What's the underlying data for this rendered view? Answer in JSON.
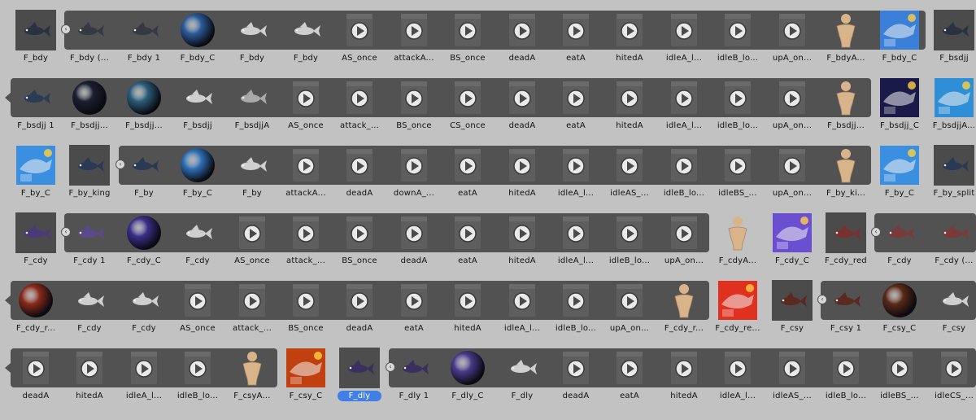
{
  "rows": [
    {
      "items": [
        {
          "label": "F_bdy",
          "icon": "mesh-icon",
          "tint": "#2a3140",
          "boxed": true
        },
        {
          "label": "F_bdy (...",
          "icon": "fish-icon",
          "tint": "#353a42"
        },
        {
          "label": "F_bdy 1",
          "icon": "fish-icon",
          "tint": "#353a42"
        },
        {
          "label": "F_bdy_C",
          "icon": "sphere-icon",
          "tint": "#2b5b9a"
        },
        {
          "label": "F_bdy",
          "icon": "fish-icon",
          "tint": "#cfcfcf"
        },
        {
          "label": "F_bdy",
          "icon": "fish-icon",
          "tint": "#cfcfcf"
        },
        {
          "label": "AS_once",
          "icon": "animation-clip-icon"
        },
        {
          "label": "attackA...",
          "icon": "animation-clip-icon"
        },
        {
          "label": "BS_once",
          "icon": "animation-clip-icon"
        },
        {
          "label": "deadA",
          "icon": "animation-clip-icon"
        },
        {
          "label": "eatA",
          "icon": "animation-clip-icon"
        },
        {
          "label": "hitedA",
          "icon": "animation-clip-icon"
        },
        {
          "label": "idleA_l...",
          "icon": "animation-clip-icon"
        },
        {
          "label": "idleB_lo...",
          "icon": "animation-clip-icon"
        },
        {
          "label": "upA_on...",
          "icon": "animation-clip-icon"
        },
        {
          "label": "F_bdyA...",
          "icon": "avatar-icon"
        },
        {
          "label": "F_bdy_C",
          "icon": "texture-icon",
          "tint": "#3a7fd8"
        },
        {
          "label": "F_bsdjj",
          "icon": "mesh-icon",
          "tint": "#2a3140",
          "boxed": true
        }
      ]
    },
    {
      "items": [
        {
          "label": "F_bsdjj 1",
          "icon": "fish-icon",
          "tint": "#2a3b55"
        },
        {
          "label": "F_bsdjj...",
          "icon": "sphere-icon",
          "tint": "#1b2030"
        },
        {
          "label": "F_bsdjj...",
          "icon": "sphere-icon",
          "tint": "#2b5e7a"
        },
        {
          "label": "F_bsdjj",
          "icon": "fish-icon",
          "tint": "#cfcfcf"
        },
        {
          "label": "F_bsdjjA",
          "icon": "fish-icon",
          "tint": "#a9a9a9"
        },
        {
          "label": "AS_once",
          "icon": "animation-clip-icon"
        },
        {
          "label": "attack_...",
          "icon": "animation-clip-icon"
        },
        {
          "label": "BS_once",
          "icon": "animation-clip-icon"
        },
        {
          "label": "CS_once",
          "icon": "animation-clip-icon"
        },
        {
          "label": "deadA",
          "icon": "animation-clip-icon"
        },
        {
          "label": "eatA",
          "icon": "animation-clip-icon"
        },
        {
          "label": "hitedA",
          "icon": "animation-clip-icon"
        },
        {
          "label": "idleA_l...",
          "icon": "animation-clip-icon"
        },
        {
          "label": "idleB_lo...",
          "icon": "animation-clip-icon"
        },
        {
          "label": "upA_on...",
          "icon": "animation-clip-icon"
        },
        {
          "label": "F_bsdjj...",
          "icon": "avatar-icon"
        },
        {
          "label": "F_bsdjj_C",
          "icon": "texture-icon",
          "tint": "#1a1a4a"
        },
        {
          "label": "F_bsdjjA...",
          "icon": "texture-icon",
          "tint": "#2f8fd6"
        }
      ]
    },
    {
      "items": [
        {
          "label": "F_by_C",
          "icon": "texture-icon",
          "tint": "#3a8fe0"
        },
        {
          "label": "F_by_king",
          "icon": "mesh-icon",
          "tint": "#2a3a55",
          "boxed": true
        },
        {
          "label": "F_by",
          "icon": "fish-icon",
          "tint": "#2a3a55"
        },
        {
          "label": "F_by_C",
          "icon": "sphere-icon",
          "tint": "#2e6fb5"
        },
        {
          "label": "F_by",
          "icon": "fish-icon",
          "tint": "#cfcfcf"
        },
        {
          "label": "attackA...",
          "icon": "animation-clip-icon"
        },
        {
          "label": "deadA",
          "icon": "animation-clip-icon"
        },
        {
          "label": "downA_...",
          "icon": "animation-clip-icon"
        },
        {
          "label": "eatA",
          "icon": "animation-clip-icon"
        },
        {
          "label": "hitedA",
          "icon": "animation-clip-icon"
        },
        {
          "label": "idleA_l...",
          "icon": "animation-clip-icon"
        },
        {
          "label": "idleAS_...",
          "icon": "animation-clip-icon"
        },
        {
          "label": "idleB_lo...",
          "icon": "animation-clip-icon"
        },
        {
          "label": "idleBS_...",
          "icon": "animation-clip-icon"
        },
        {
          "label": "upA_on...",
          "icon": "animation-clip-icon"
        },
        {
          "label": "F_by_ki...",
          "icon": "avatar-icon"
        },
        {
          "label": "F_by_C",
          "icon": "texture-icon",
          "tint": "#3a8fe0"
        },
        {
          "label": "F_by_split",
          "icon": "mesh-icon",
          "tint": "#2a3a55",
          "boxed": true
        }
      ]
    },
    {
      "items": [
        {
          "label": "F_cdy",
          "icon": "mesh-icon",
          "tint": "#4a3a7a",
          "boxed": true
        },
        {
          "label": "F_cdy 1",
          "icon": "fish-icon",
          "tint": "#5a4a8a"
        },
        {
          "label": "F_cdy_C",
          "icon": "sphere-icon",
          "tint": "#3a2f8a"
        },
        {
          "label": "F_cdy",
          "icon": "fish-icon",
          "tint": "#cfcfcf"
        },
        {
          "label": "AS_once",
          "icon": "animation-clip-icon"
        },
        {
          "label": "attack_...",
          "icon": "animation-clip-icon"
        },
        {
          "label": "BS_once",
          "icon": "animation-clip-icon"
        },
        {
          "label": "deadA",
          "icon": "animation-clip-icon"
        },
        {
          "label": "eatA",
          "icon": "animation-clip-icon"
        },
        {
          "label": "hitedA",
          "icon": "animation-clip-icon"
        },
        {
          "label": "idleA_l...",
          "icon": "animation-clip-icon"
        },
        {
          "label": "idleB_lo...",
          "icon": "animation-clip-icon"
        },
        {
          "label": "upA_on...",
          "icon": "animation-clip-icon"
        },
        {
          "label": "F_cdyA...",
          "icon": "avatar-icon"
        },
        {
          "label": "F_cdy_C",
          "icon": "texture-icon",
          "tint": "#6a4fd0"
        },
        {
          "label": "F_cdy_red",
          "icon": "mesh-icon",
          "tint": "#7a3030",
          "boxed": true
        },
        {
          "label": "F_cdy",
          "icon": "fish-icon",
          "tint": "#7a3a3a"
        },
        {
          "label": "F_cdy (...",
          "icon": "fish-icon",
          "tint": "#7a3a3a"
        }
      ]
    },
    {
      "items": [
        {
          "label": "F_cdy_r...",
          "icon": "sphere-icon",
          "tint": "#8a2a1a"
        },
        {
          "label": "F_cdy",
          "icon": "fish-icon",
          "tint": "#cfcfcf"
        },
        {
          "label": "F_cdy",
          "icon": "fish-icon",
          "tint": "#cfcfcf"
        },
        {
          "label": "AS_once",
          "icon": "animation-clip-icon"
        },
        {
          "label": "attack_...",
          "icon": "animation-clip-icon"
        },
        {
          "label": "BS_once",
          "icon": "animation-clip-icon"
        },
        {
          "label": "deadA",
          "icon": "animation-clip-icon"
        },
        {
          "label": "eatA",
          "icon": "animation-clip-icon"
        },
        {
          "label": "hitedA",
          "icon": "animation-clip-icon"
        },
        {
          "label": "idleA_l...",
          "icon": "animation-clip-icon"
        },
        {
          "label": "idleB_lo...",
          "icon": "animation-clip-icon"
        },
        {
          "label": "upA_on...",
          "icon": "animation-clip-icon"
        },
        {
          "label": "F_cdy_r...",
          "icon": "avatar-icon"
        },
        {
          "label": "F_cdy_re...",
          "icon": "texture-icon",
          "tint": "#e03020"
        },
        {
          "label": "F_csy",
          "icon": "mesh-icon",
          "tint": "#5a2a20",
          "boxed": true
        },
        {
          "label": "F_csy 1",
          "icon": "fish-icon",
          "tint": "#5a2a20"
        },
        {
          "label": "F_csy_C",
          "icon": "sphere-icon",
          "tint": "#5a2a18"
        },
        {
          "label": "F_csy",
          "icon": "fish-icon",
          "tint": "#cfcfcf"
        }
      ]
    },
    {
      "items": [
        {
          "label": "deadA",
          "icon": "animation-clip-icon"
        },
        {
          "label": "hitedA",
          "icon": "animation-clip-icon"
        },
        {
          "label": "idleA_l...",
          "icon": "animation-clip-icon"
        },
        {
          "label": "idleB_lo...",
          "icon": "animation-clip-icon"
        },
        {
          "label": "F_csyA...",
          "icon": "avatar-icon"
        },
        {
          "label": "F_csy_C",
          "icon": "texture-icon",
          "tint": "#c04010"
        },
        {
          "label": "F_dly",
          "icon": "mesh-icon",
          "tint": "#3a3060",
          "boxed": true,
          "selected": true
        },
        {
          "label": "F_dly 1",
          "icon": "fish-icon",
          "tint": "#3a3060"
        },
        {
          "label": "F_dly_C",
          "icon": "sphere-icon",
          "tint": "#4a3a8a"
        },
        {
          "label": "F_dly",
          "icon": "fish-icon",
          "tint": "#cfcfcf"
        },
        {
          "label": "deadA",
          "icon": "animation-clip-icon"
        },
        {
          "label": "eatA",
          "icon": "animation-clip-icon"
        },
        {
          "label": "hitedA",
          "icon": "animation-clip-icon"
        },
        {
          "label": "idleA_l...",
          "icon": "animation-clip-icon"
        },
        {
          "label": "idleAS_...",
          "icon": "animation-clip-icon"
        },
        {
          "label": "idleB_lo...",
          "icon": "animation-clip-icon"
        },
        {
          "label": "idleBS_...",
          "icon": "animation-clip-icon"
        },
        {
          "label": "idleCS_...",
          "icon": "animation-clip-icon"
        }
      ]
    }
  ],
  "colors": {
    "background": "#c2c2c2",
    "strip": "#525252",
    "clip_tile": "#5e5e5e",
    "selection": "#3f7fe6"
  }
}
